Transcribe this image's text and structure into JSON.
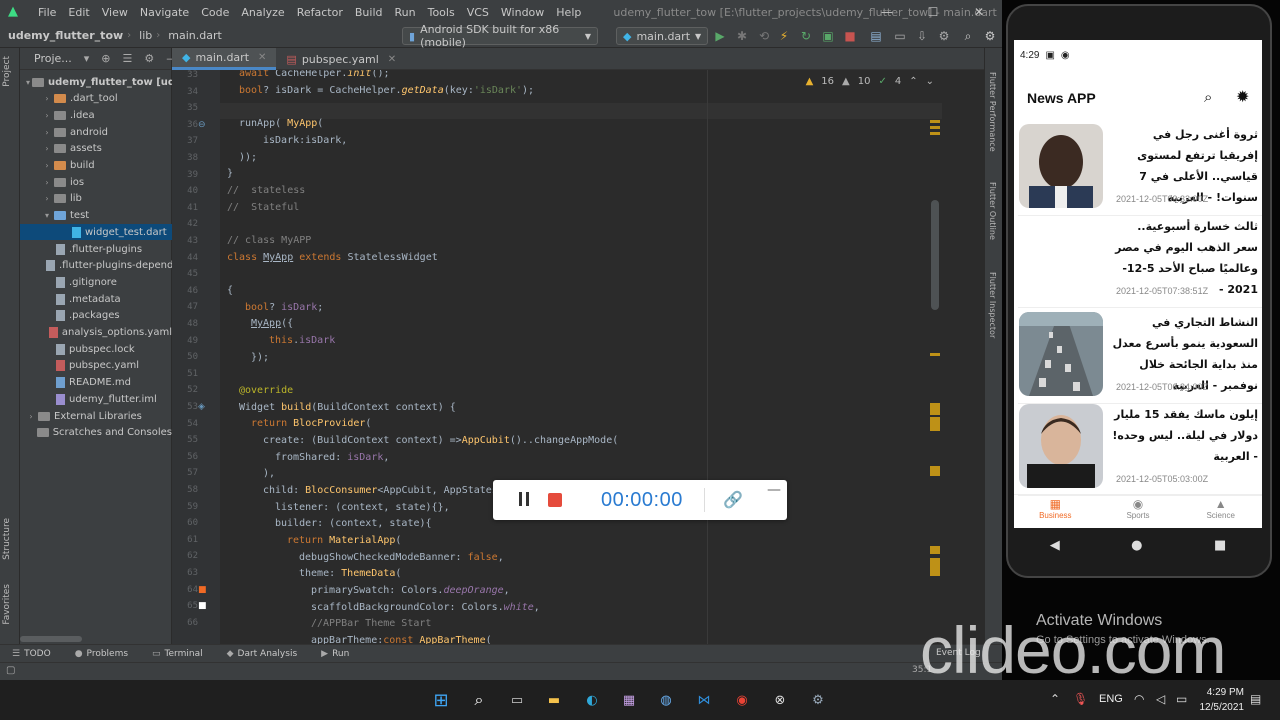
{
  "ide": {
    "menu": [
      "File",
      "Edit",
      "View",
      "Navigate",
      "Code",
      "Analyze",
      "Refactor",
      "Build",
      "Run",
      "Tools",
      "VCS",
      "Window",
      "Help"
    ],
    "window_title": "udemy_flutter_tow [E:\\flutter_projects\\udemy_flutter_tow] - main.dart",
    "breadcrumbs": [
      "udemy_flutter_tow",
      "lib",
      "main.dart"
    ],
    "device": "Android SDK built for x86 (mobile)",
    "run_config": "main.dart",
    "tabs": [
      {
        "label": "main.dart",
        "active": true
      },
      {
        "label": "pubspec.yaml",
        "active": false
      }
    ],
    "project_panel_title": "Proje...",
    "tree": [
      {
        "label": "udemy_flutter_tow [udemy",
        "indent": 0,
        "arrow": "▾",
        "kind": "root"
      },
      {
        "label": ".dart_tool",
        "indent": 1,
        "arrow": "›",
        "kind": "folder-orange"
      },
      {
        "label": ".idea",
        "indent": 1,
        "arrow": "›",
        "kind": "folder"
      },
      {
        "label": "android",
        "indent": 1,
        "arrow": "›",
        "kind": "folder"
      },
      {
        "label": "assets",
        "indent": 1,
        "arrow": "›",
        "kind": "folder"
      },
      {
        "label": "build",
        "indent": 1,
        "arrow": "›",
        "kind": "folder-orange"
      },
      {
        "label": "ios",
        "indent": 1,
        "arrow": "›",
        "kind": "folder"
      },
      {
        "label": "lib",
        "indent": 1,
        "arrow": "›",
        "kind": "folder"
      },
      {
        "label": "test",
        "indent": 1,
        "arrow": "▾",
        "kind": "folder-blue"
      },
      {
        "label": "widget_test.dart",
        "indent": 2,
        "arrow": "",
        "kind": "dart",
        "selected": true
      },
      {
        "label": ".flutter-plugins",
        "indent": 1,
        "arrow": "",
        "kind": "file"
      },
      {
        "label": ".flutter-plugins-depend",
        "indent": 1,
        "arrow": "",
        "kind": "file"
      },
      {
        "label": ".gitignore",
        "indent": 1,
        "arrow": "",
        "kind": "file"
      },
      {
        "label": ".metadata",
        "indent": 1,
        "arrow": "",
        "kind": "file"
      },
      {
        "label": ".packages",
        "indent": 1,
        "arrow": "",
        "kind": "file"
      },
      {
        "label": "analysis_options.yaml",
        "indent": 1,
        "arrow": "",
        "kind": "yaml"
      },
      {
        "label": "pubspec.lock",
        "indent": 1,
        "arrow": "",
        "kind": "file"
      },
      {
        "label": "pubspec.yaml",
        "indent": 1,
        "arrow": "",
        "kind": "yaml"
      },
      {
        "label": "README.md",
        "indent": 1,
        "arrow": "",
        "kind": "md"
      },
      {
        "label": "udemy_flutter.iml",
        "indent": 1,
        "arrow": "",
        "kind": "iml"
      },
      {
        "label": "External Libraries",
        "indent": 0,
        "arrow": "›",
        "kind": "lib"
      },
      {
        "label": "Scratches and Consoles",
        "indent": 0,
        "arrow": "",
        "kind": "lib"
      }
    ],
    "inspections": {
      "warnings": "16",
      "weak": "10",
      "ok": "4"
    },
    "line_numbers": [
      "33",
      "34",
      "35",
      "36",
      "37",
      "38",
      "39",
      "40",
      "41",
      "42",
      "43",
      "44",
      "45",
      "46",
      "47",
      "48",
      "49",
      "50",
      "51",
      "52",
      "53",
      "54",
      "55",
      "56",
      "57",
      "58",
      "59",
      "60",
      "61",
      "62",
      "63",
      "64",
      "65",
      "66"
    ],
    "left_vtabs": [
      "Project",
      "Structure",
      "Favorites"
    ],
    "right_vtabs": [
      "Flutter Performance",
      "Flutter Outline",
      "Flutter Inspector"
    ],
    "tool_tabs": [
      "TODO",
      "Problems",
      "Terminal",
      "Dart Analysis",
      "Run"
    ],
    "event_log": "Event Log",
    "cursor_pos": "35:1"
  },
  "recorder": {
    "time": "00:00:00"
  },
  "phone": {
    "time": "4:29",
    "app_title": "News APP",
    "articles": [
      {
        "title": "ثروة أغنى رجل في إفريقيا ترتفع لمستوى قياسي.. الأعلى في 7 سنوات! - العربية",
        "date": "2021-12-05T09:32:00Z",
        "image": "portrait-dark"
      },
      {
        "title": "ثالث خسارة أسبوعية.. سعر الذهب اليوم في مصر وعالميًا صباح الأحد 5-12-2021 -",
        "date": "2021-12-05T07:38:51Z",
        "image": "none"
      },
      {
        "title": "النشاط التجاري في السعودية ينمو بأسرع معدل منذ بداية الجائحة خلال نوفمبر - العربية",
        "date": "2021-12-05T06:34:00Z",
        "image": "highway"
      },
      {
        "title": "إيلون ماسك يفقد 15 مليار دولار في ليلة.. ليس وحده! - العربية",
        "date": "2021-12-05T05:03:00Z",
        "image": "portrait-light"
      }
    ],
    "bottom_nav": [
      {
        "label": "Business",
        "icon": "business-icon",
        "active": true
      },
      {
        "label": "Sports",
        "icon": "sports-icon",
        "active": false
      },
      {
        "label": "Science",
        "icon": "science-icon",
        "active": false
      }
    ]
  },
  "watermark": {
    "activate_title": "Activate Windows",
    "activate_sub": "Go to Settings to activate Windows.",
    "brand": "clideo.com"
  },
  "taskbar": {
    "lang": "ENG",
    "time": "4:29 PM",
    "date": "12/5/2021"
  },
  "colors": {
    "accent_orange": "#f06a25",
    "ide_bg": "#2b2b2b",
    "recorder_time": "#2a7bd1"
  }
}
